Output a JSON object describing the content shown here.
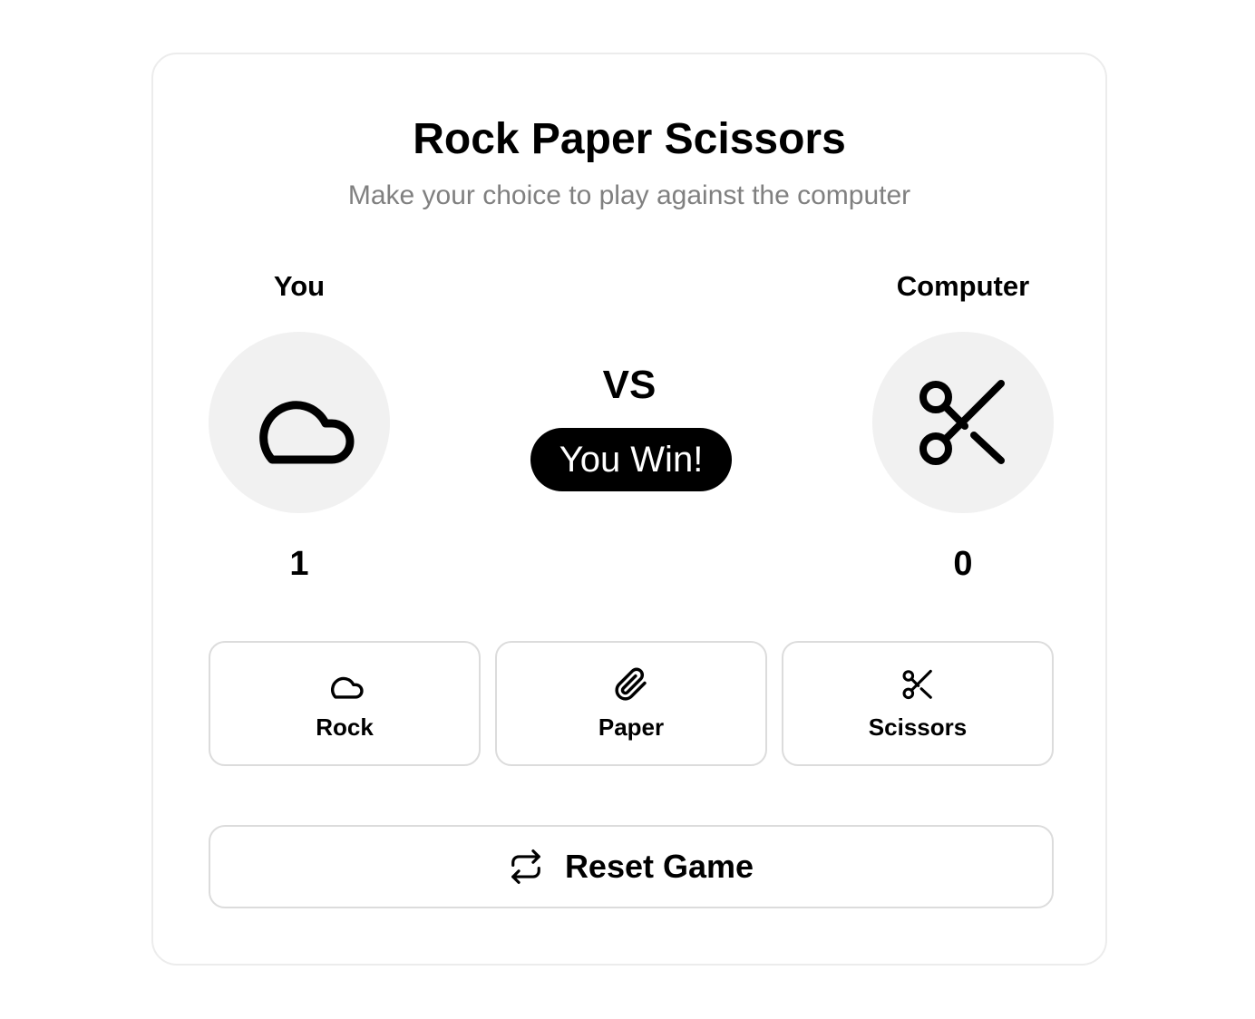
{
  "app": {
    "title": "Rock Paper Scissors",
    "subtitle": "Make your choice to play against the computer"
  },
  "players": {
    "you": {
      "label": "You",
      "choice_icon": "cloud-icon",
      "score": "1"
    },
    "computer": {
      "label": "Computer",
      "choice_icon": "scissors-icon",
      "score": "0"
    }
  },
  "match": {
    "vs_label": "VS",
    "result": "You Win!"
  },
  "choices": [
    {
      "label": "Rock",
      "icon": "cloud-icon"
    },
    {
      "label": "Paper",
      "icon": "paperclip-icon"
    },
    {
      "label": "Scissors",
      "icon": "scissors-icon"
    }
  ],
  "reset": {
    "label": "Reset Game",
    "icon": "repeat-icon"
  },
  "colors": {
    "text": "#000000",
    "muted": "#808080",
    "circle_bg": "#f1f1f1",
    "border": "#dcdcdc",
    "badge_bg": "#000000",
    "badge_text": "#ffffff"
  }
}
